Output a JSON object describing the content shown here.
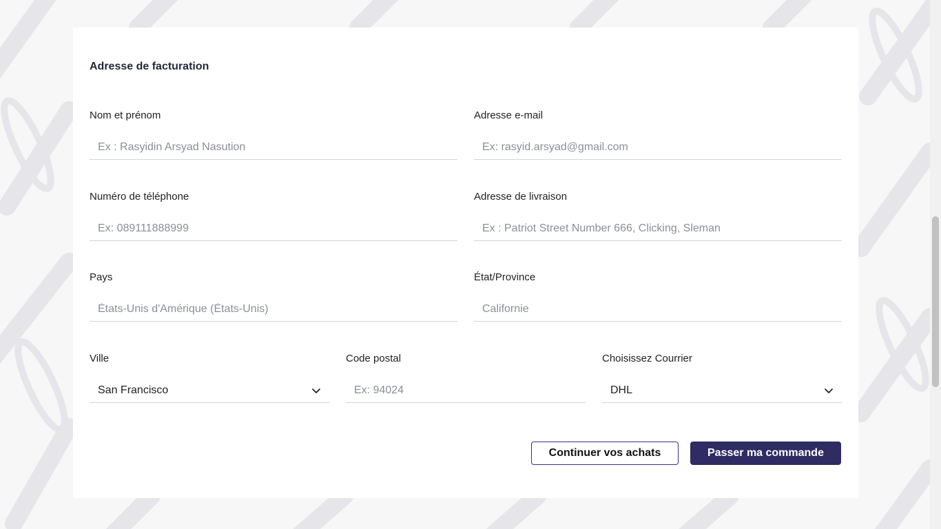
{
  "form": {
    "title": "Adresse de facturation",
    "fields": {
      "name": {
        "label": "Nom et prénom",
        "placeholder": "Ex : Rasyidin Arsyad Nasution"
      },
      "email": {
        "label": "Adresse e-mail",
        "placeholder": "Ex: rasyid.arsyad@gmail.com"
      },
      "phone": {
        "label": "Numéro de téléphone",
        "placeholder": "Ex: 089111888999"
      },
      "shipping_address": {
        "label": "Adresse de livraison",
        "placeholder": "Ex : Patriot Street Number 666, Clicking, Sleman"
      },
      "country": {
        "label": "Pays",
        "placeholder": "États-Unis d'Amérique (États-Unis)"
      },
      "state": {
        "label": "État/Province",
        "placeholder": "Californie"
      },
      "city": {
        "label": "Ville",
        "value": "San Francisco",
        "icon": "chevron-down-icon"
      },
      "postal_code": {
        "label": "Code postal",
        "placeholder": "Ex: 94024"
      },
      "courier": {
        "label": "Choisissez Courrier",
        "value": "DHL",
        "icon": "chevron-down-icon"
      }
    },
    "buttons": {
      "continue_shopping": "Continuer vos achats",
      "place_order": "Passer ma commande"
    }
  },
  "colors": {
    "background": "#f7f7f8",
    "pattern": "#e7e7ea",
    "primary": "#2f2b63",
    "outline_border": "#3b2f86"
  }
}
